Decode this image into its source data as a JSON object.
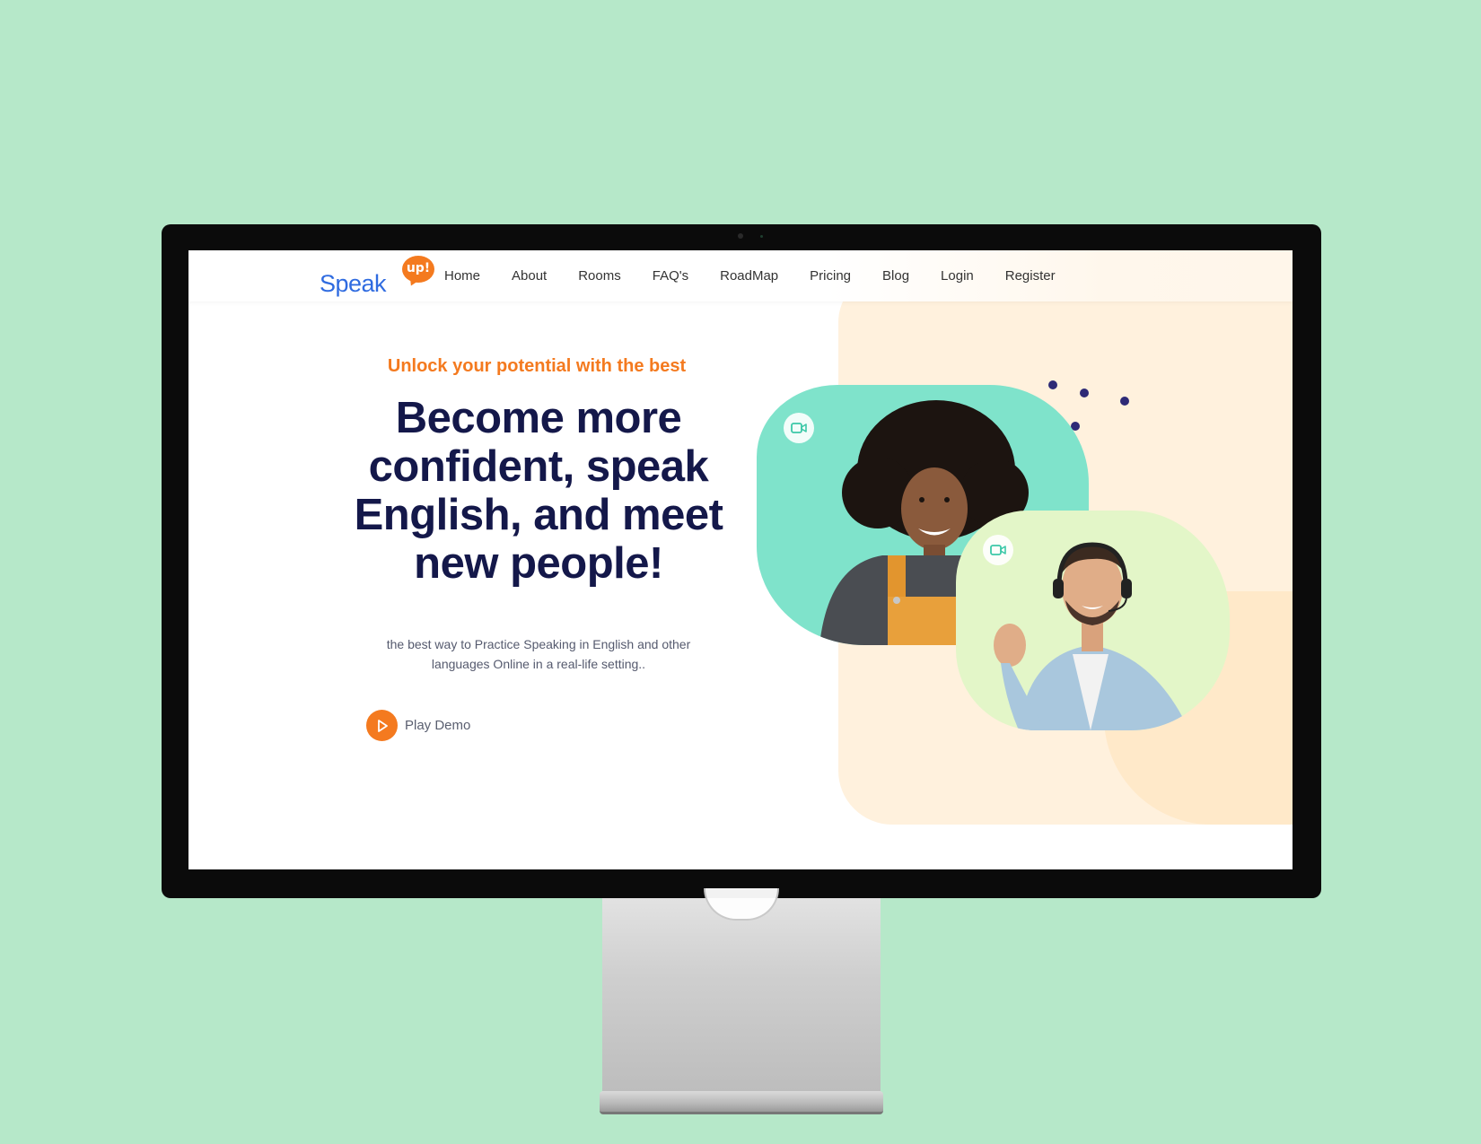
{
  "site": {
    "logo_text": "Speak",
    "logo_bubble": "up!"
  },
  "nav": {
    "items": [
      "Home",
      "About",
      "Rooms",
      "FAQ's",
      "RoadMap",
      "Pricing",
      "Blog",
      "Login",
      "Register"
    ]
  },
  "hero": {
    "tagline": "Unlock your potential with the best",
    "headline": "Become more confident, speak English, and meet new people!",
    "subtext": "the best way to Practice Speaking in English and other languages Online in a real-life setting..",
    "play_demo_label": "Play Demo"
  },
  "icons": {
    "play": "play-icon",
    "video": "video-camera-icon"
  },
  "colors": {
    "page_background": "#b6e8c9",
    "accent_orange": "#f47a1f",
    "headline_navy": "#14184a",
    "logo_blue": "#2f6be0",
    "teal_card": "#7fe3cb",
    "lime_card": "#e3f6c8",
    "peach_blob": "#fff1dd",
    "dots": "#2e2a76"
  }
}
